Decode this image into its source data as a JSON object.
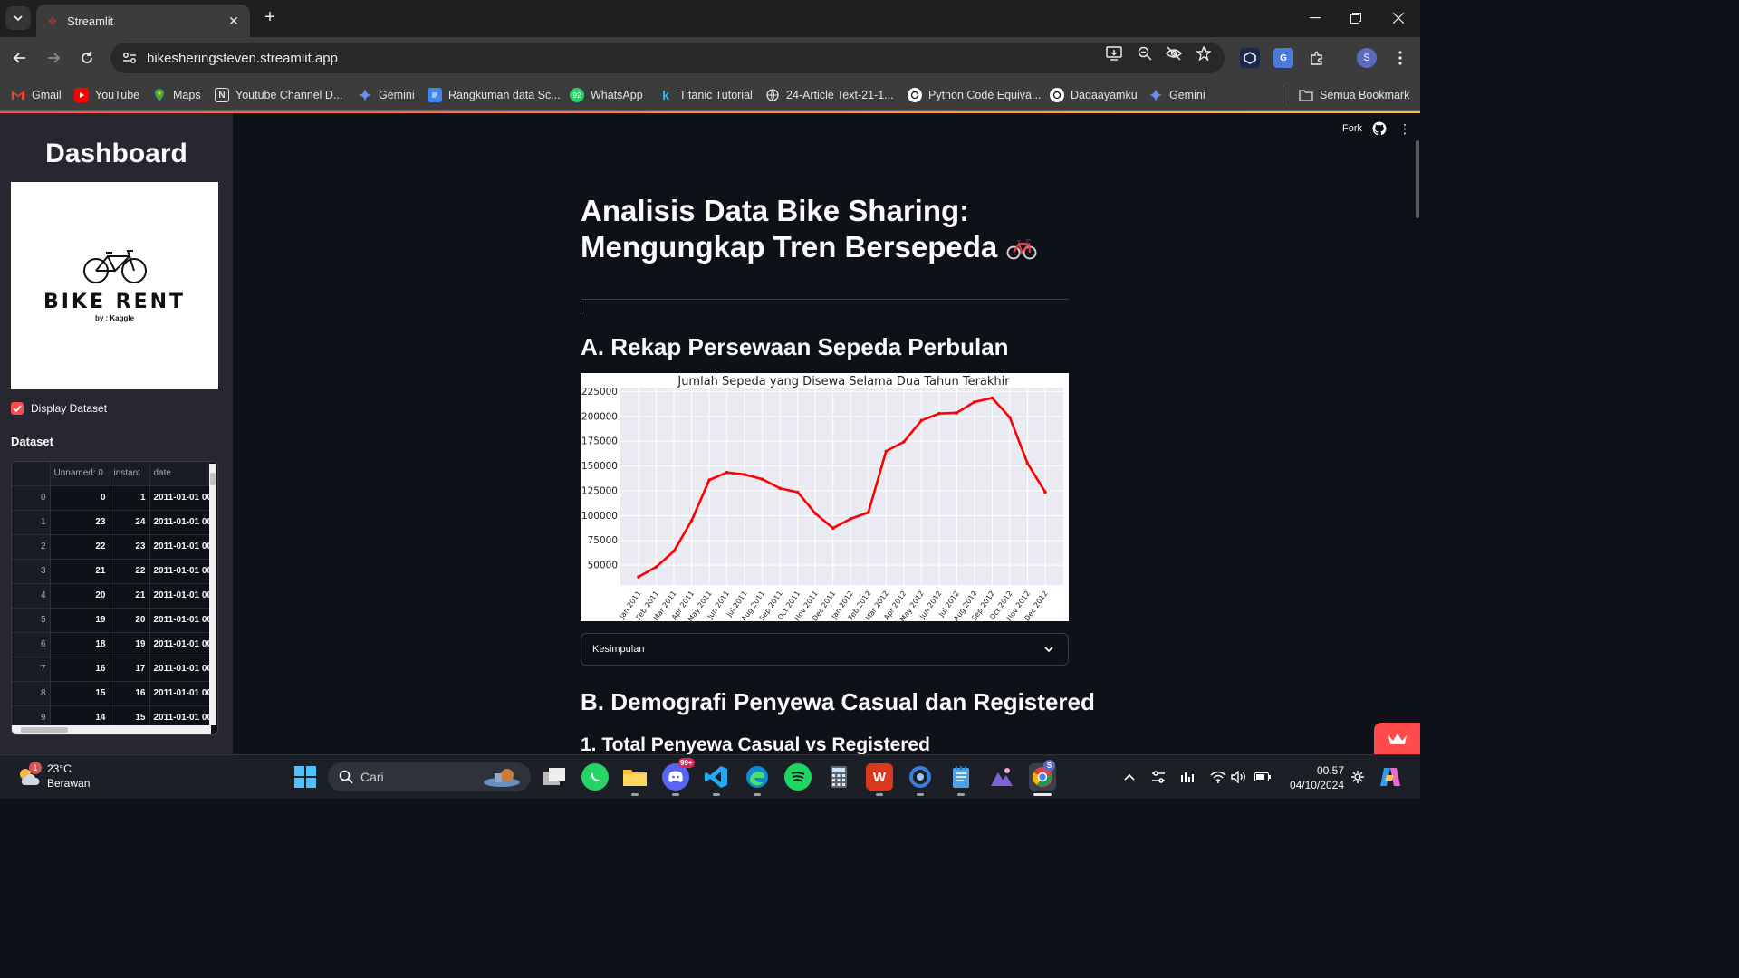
{
  "browser": {
    "tab_title": "Streamlit",
    "url": "bikesheringsteven.streamlit.app",
    "bookmarks": [
      {
        "label": "Gmail"
      },
      {
        "label": "YouTube"
      },
      {
        "label": "Maps"
      },
      {
        "label": "Youtube Channel D..."
      },
      {
        "label": "Gemini"
      },
      {
        "label": "Rangkuman data Sc..."
      },
      {
        "label": "WhatsApp"
      },
      {
        "label": "Titanic Tutorial"
      },
      {
        "label": "24-Article Text-21-1..."
      },
      {
        "label": "Python Code Equiva..."
      },
      {
        "label": "Dadaayamku"
      },
      {
        "label": "Gemini"
      }
    ],
    "all_bookmarks": "Semua Bookmark",
    "profile_initial": "S"
  },
  "sidebar": {
    "title": "Dashboard",
    "logo_text": "BIKE RENT",
    "logo_sub": "by : Kaggle",
    "checkbox_label": "Display Dataset",
    "dataset_label": "Dataset",
    "table": {
      "columns": [
        "",
        "Unnamed: 0",
        "instant",
        "date"
      ],
      "rows": [
        [
          "0",
          "0",
          "1",
          "2011-01-01 00"
        ],
        [
          "1",
          "23",
          "24",
          "2011-01-01 00"
        ],
        [
          "2",
          "22",
          "23",
          "2011-01-01 00"
        ],
        [
          "3",
          "21",
          "22",
          "2011-01-01 00"
        ],
        [
          "4",
          "20",
          "21",
          "2011-01-01 00"
        ],
        [
          "5",
          "19",
          "20",
          "2011-01-01 00"
        ],
        [
          "6",
          "18",
          "19",
          "2011-01-01 00"
        ],
        [
          "7",
          "16",
          "17",
          "2011-01-01 00"
        ],
        [
          "8",
          "15",
          "16",
          "2011-01-01 00"
        ],
        [
          "9",
          "14",
          "15",
          "2011-01-01 00"
        ]
      ]
    }
  },
  "main": {
    "header_fork": "Fork",
    "title_line1": "Analisis Data Bike Sharing:",
    "title_line2": "Mengungkap Tren Bersepeda",
    "section_a": "A. Rekap Persewaan Sepeda Perbulan",
    "expander_label": "Kesimpulan",
    "section_b": "B. Demografi Penyewa Casual dan Registered",
    "section_b1": "1. Total Penyewa Casual vs Registered"
  },
  "chart_data": {
    "type": "line",
    "title": "Jumlah Sepeda yang Disewa Selama Dua Tahun Terakhir",
    "xlabel": "",
    "ylabel": "",
    "categories": [
      "Jan 2011",
      "Feb 2011",
      "Mar 2011",
      "Apr 2011",
      "May 2011",
      "Jun 2011",
      "Jul 2011",
      "Aug 2011",
      "Sep 2011",
      "Oct 2011",
      "Nov 2011",
      "Dec 2011",
      "Jan 2012",
      "Feb 2012",
      "Mar 2012",
      "Apr 2012",
      "May 2012",
      "Jun 2012",
      "Jul 2012",
      "Aug 2012",
      "Sep 2012",
      "Oct 2012",
      "Nov 2012",
      "Dec 2012"
    ],
    "values": [
      38189,
      48215,
      64045,
      94870,
      135821,
      143512,
      141341,
      136691,
      127418,
      123511,
      102167,
      87323,
      96744,
      103137,
      164875,
      174224,
      195865,
      202830,
      203607,
      214503,
      218573,
      198841,
      152664,
      123713
    ],
    "yticks": [
      50000,
      75000,
      100000,
      125000,
      150000,
      175000,
      200000,
      225000
    ],
    "ylim": [
      30000,
      229000
    ],
    "grid": true,
    "background": "#eaeaf2",
    "line_color": "#ff0000"
  },
  "taskbar": {
    "weather_temp": "23°C",
    "weather_desc": "Berawan",
    "weather_badge": "1",
    "search_placeholder": "Cari",
    "time": "00.57",
    "date": "04/10/2024"
  }
}
